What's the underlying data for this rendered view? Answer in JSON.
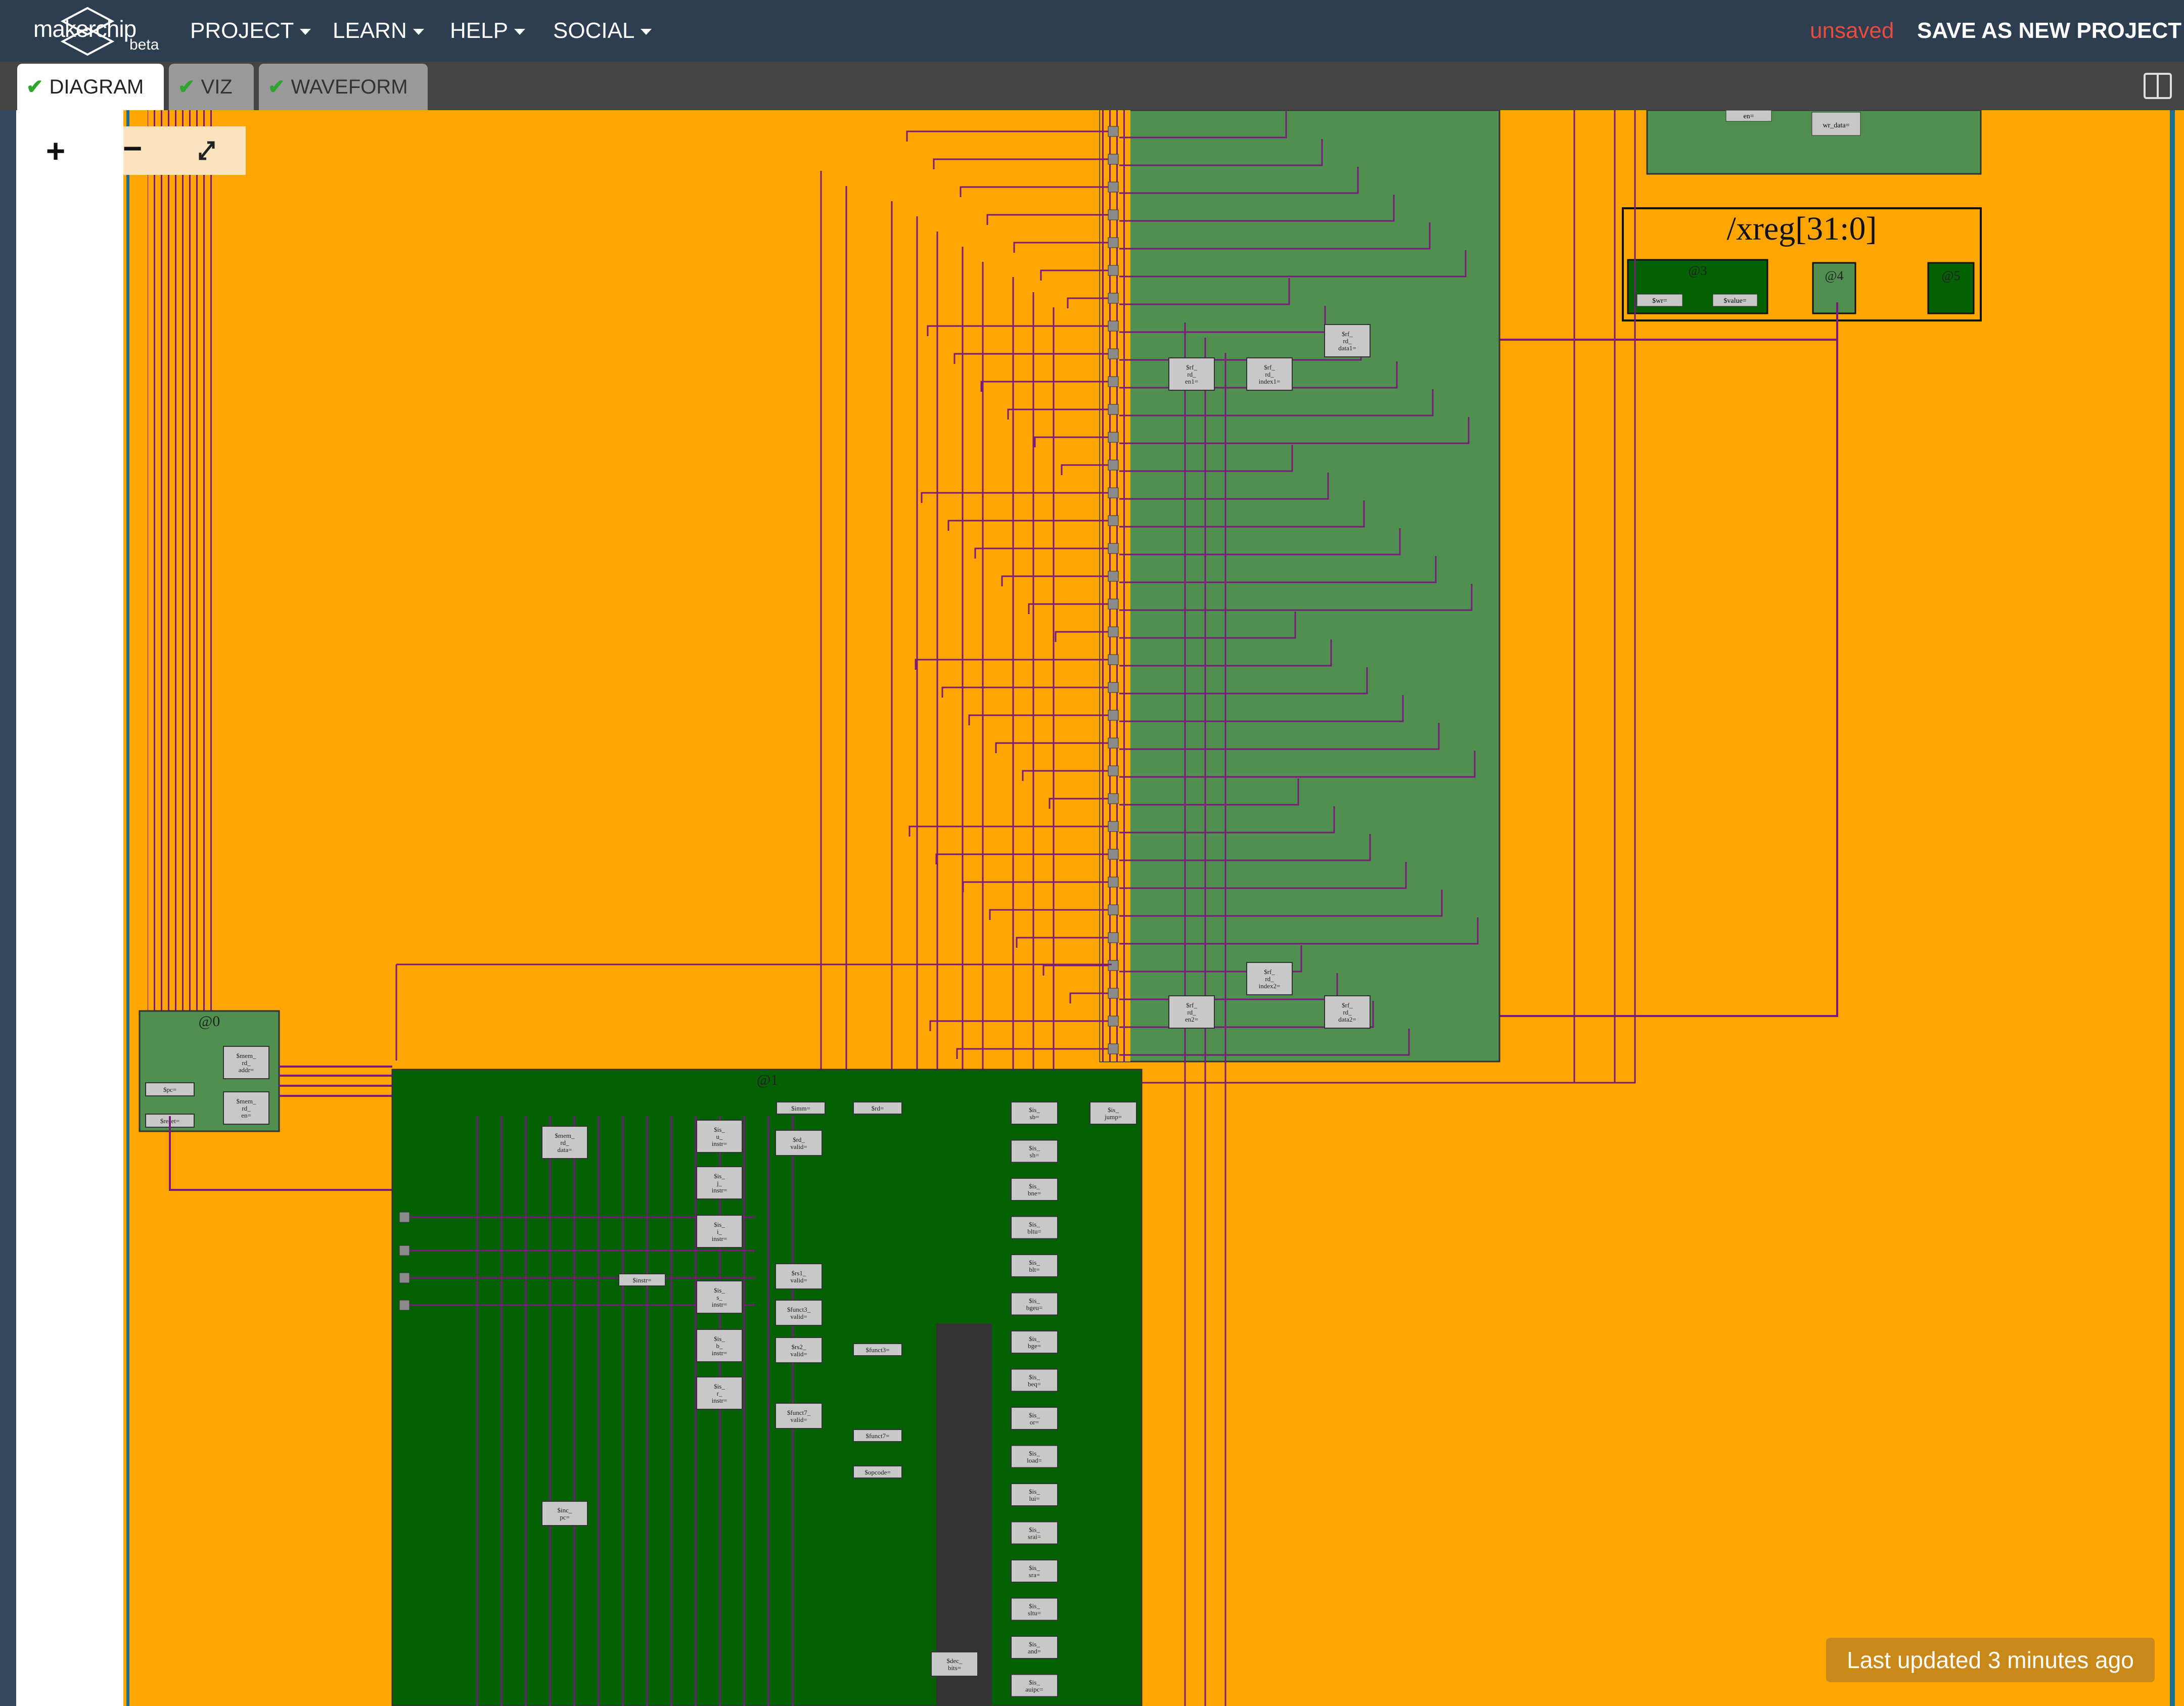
{
  "header": {
    "logo_text": "makerchip",
    "logo_beta": "beta",
    "menus": [
      {
        "label": "PROJECT"
      },
      {
        "label": "LEARN"
      },
      {
        "label": "HELP"
      },
      {
        "label": "SOCIAL"
      }
    ],
    "save_status": "unsaved",
    "save_new_label": "SAVE AS NEW PROJECT"
  },
  "tabs": [
    {
      "label": "DIAGRAM",
      "active": true
    },
    {
      "label": "VIZ",
      "active": false
    },
    {
      "label": "WAVEFORM",
      "active": false
    }
  ],
  "zoom": {
    "in_label": "+",
    "out_label": "−"
  },
  "diagram": {
    "colors": {
      "background": "#ffa500",
      "stage_bright": "#4f8f4f",
      "stage_dark": "#036003",
      "wire": "#7a1a7a",
      "signal_box": "#c8c8c8"
    },
    "xreg_label": "/xreg[31:0]",
    "stages": [
      "@0",
      "@1",
      "@3",
      "@4",
      "@5"
    ],
    "stage0_signals": [
      "$mem_rd_addr=",
      "$mem_rd_en=",
      "$pc=",
      "$reset="
    ],
    "stage1_signals": [
      "$mem_rd_data=",
      "$is_u_instr=",
      "$is_j_instr=",
      "$is_i_instr=",
      "$instr=",
      "$is_s_instr=",
      "$is_b_instr=",
      "$is_r_instr=",
      "$inc_pc=",
      "$imm=",
      "$rd=",
      "$rd_valid=",
      "$rs1_valid=",
      "$funct3_valid=",
      "$rs2_valid=",
      "$funct3=",
      "$funct7_valid=",
      "$funct7=",
      "$opcode=",
      "$dec_bits="
    ],
    "decode_signals": [
      "$is_sb=",
      "$is_sh=",
      "$is_bne=",
      "$is_bltu=",
      "$is_blt=",
      "$is_bgeu=",
      "$is_bge=",
      "$is_beq=",
      "$is_or=",
      "$is_load=",
      "$is_lui=",
      "$is_srai=",
      "$is_sra=",
      "$is_sltu=",
      "$is_and=",
      "$is_auipc=",
      "$is_jump="
    ],
    "rf_signals": [
      "$rf_rd_en1=",
      "$rf_rd_index1=",
      "$rf_rd_data1=",
      "$rf_rd_en2=",
      "$rf_rd_index2=",
      "$rf_rd_data2="
    ],
    "xreg_signals": [
      "$wr=",
      "$value="
    ],
    "top_signals": [
      "en=",
      "wr_data="
    ]
  },
  "toast": "Last updated 3 minutes ago"
}
